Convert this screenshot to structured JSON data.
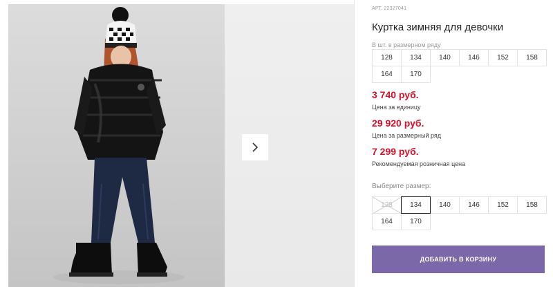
{
  "product": {
    "article": "АРТ. 22327041",
    "title": "Куртка зимняя для девочки",
    "image_alt": "girl-in-black-winter-jacket-photo"
  },
  "size_row": {
    "hint": "В шт. в размерном ряду",
    "sizes": [
      "128",
      "134",
      "140",
      "146",
      "152",
      "158",
      "164",
      "170"
    ]
  },
  "prices": {
    "unit_price": "3 740 руб.",
    "unit_label": "Цена за единицу",
    "row_price": "29 920 руб.",
    "row_label": "Цена за размерный ряд",
    "retail_price": "7 299 руб.",
    "retail_label": "Рекомендуемая розничная цена",
    "price_color": "#d5112a"
  },
  "size_picker": {
    "hint": "Выберите размер:",
    "sizes": [
      {
        "label": "128",
        "state": "disabled"
      },
      {
        "label": "134",
        "state": "selected"
      },
      {
        "label": "140",
        "state": "available"
      },
      {
        "label": "146",
        "state": "available"
      },
      {
        "label": "152",
        "state": "available"
      },
      {
        "label": "158",
        "state": "available"
      },
      {
        "label": "164",
        "state": "available"
      },
      {
        "label": "170",
        "state": "available"
      }
    ]
  },
  "cart": {
    "label": "ДОБАВИТЬ В КОРЗИНУ",
    "color": "#7b68a8"
  },
  "gallery": {
    "next_icon": "chevron-right-icon"
  }
}
